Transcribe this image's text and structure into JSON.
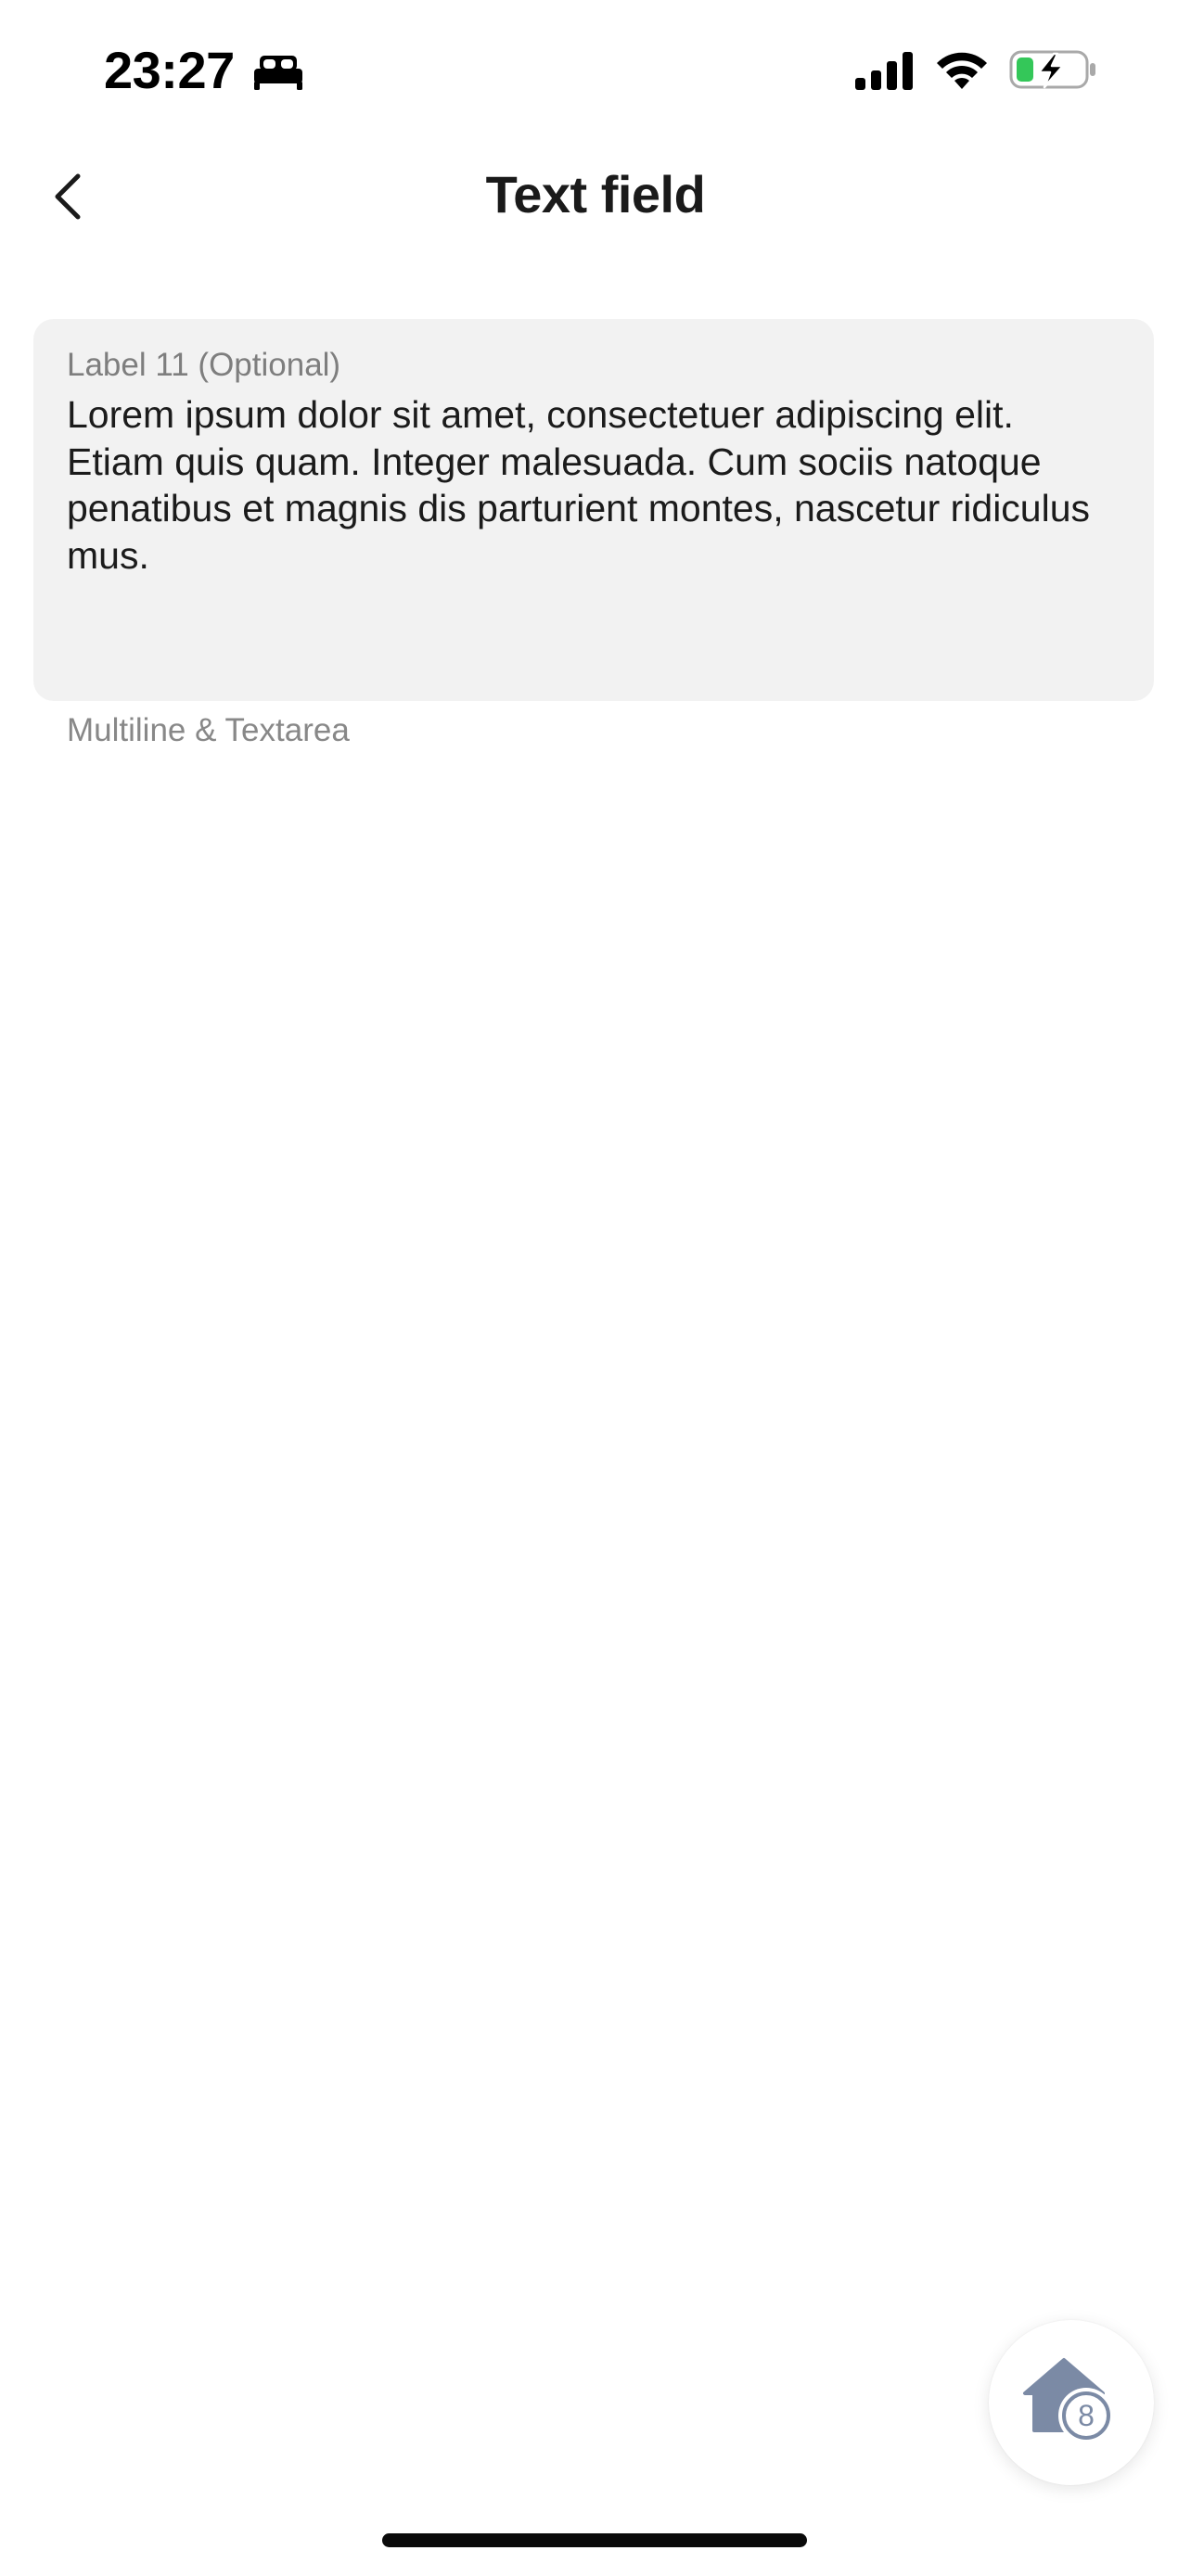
{
  "status_bar": {
    "time": "23:27",
    "focus_icon": "bed-icon",
    "signal_icon": "cellular-signal-icon",
    "wifi_icon": "wifi-icon",
    "battery_icon": "battery-charging-icon",
    "battery_color": "#34c759"
  },
  "nav": {
    "back_icon": "chevron-left-icon",
    "title": "Text field"
  },
  "textarea": {
    "label": "Label 11 (Optional)",
    "value": "Lorem ipsum dolor sit amet, consectetuer adipiscing elit. Etiam quis quam. Integer malesuada. Cum sociis natoque penatibus et magnis dis parturient montes, nascetur ridiculus mus.",
    "helper": "Multiline & Textarea"
  },
  "fab": {
    "icon": "home-icon",
    "badge": "8",
    "color": "#7b8aa5"
  }
}
